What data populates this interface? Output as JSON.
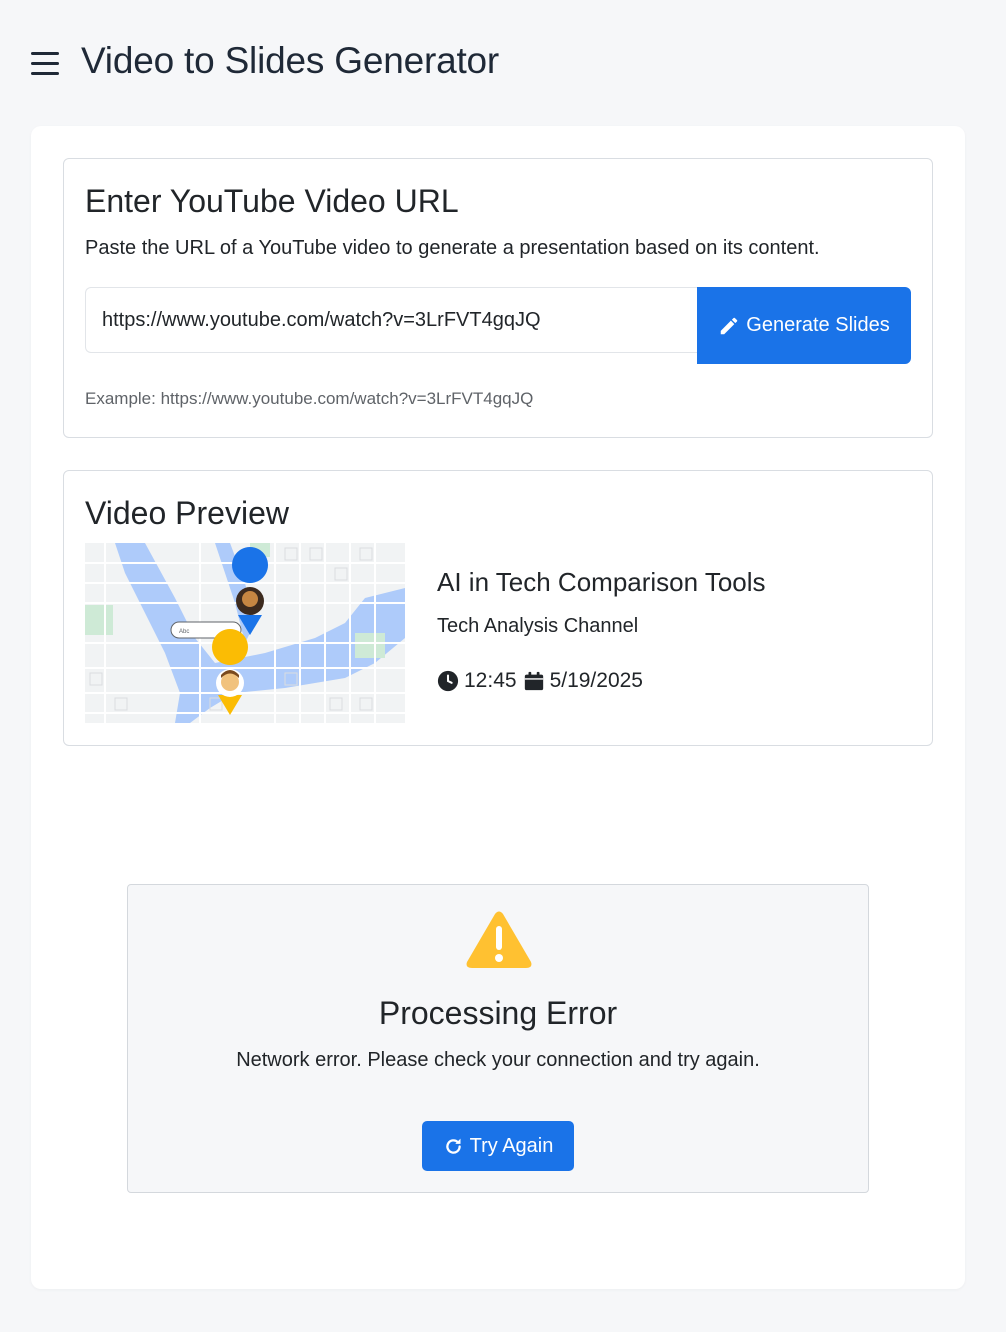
{
  "header": {
    "title": "Video to Slides Generator",
    "menu_icon": "hamburger-menu-icon"
  },
  "url_section": {
    "title": "Enter YouTube Video URL",
    "description": "Paste the URL of a YouTube video to generate a presentation based on its content.",
    "input_value": "https://www.youtube.com/watch?v=3LrFVT4gqJQ",
    "generate_label": "Generate Slides",
    "generate_icon": "pencil-icon",
    "example": "Example: https://www.youtube.com/watch?v=3LrFVT4gqJQ"
  },
  "preview": {
    "title": "Video Preview",
    "video_title": "AI in Tech Comparison Tools",
    "channel": "Tech Analysis Channel",
    "duration": "12:45",
    "date": "5/19/2025",
    "thumbnail_label": "Abc",
    "duration_icon": "clock-icon",
    "date_icon": "calendar-icon"
  },
  "error": {
    "title": "Processing Error",
    "message": "Network error. Please check your connection and try again.",
    "retry_label": "Try Again",
    "retry_icon": "redo-icon",
    "warning_icon": "warning-triangle-icon"
  },
  "colors": {
    "primary": "#1a73e8",
    "warning": "#ffc131",
    "background": "#f6f7f9"
  }
}
